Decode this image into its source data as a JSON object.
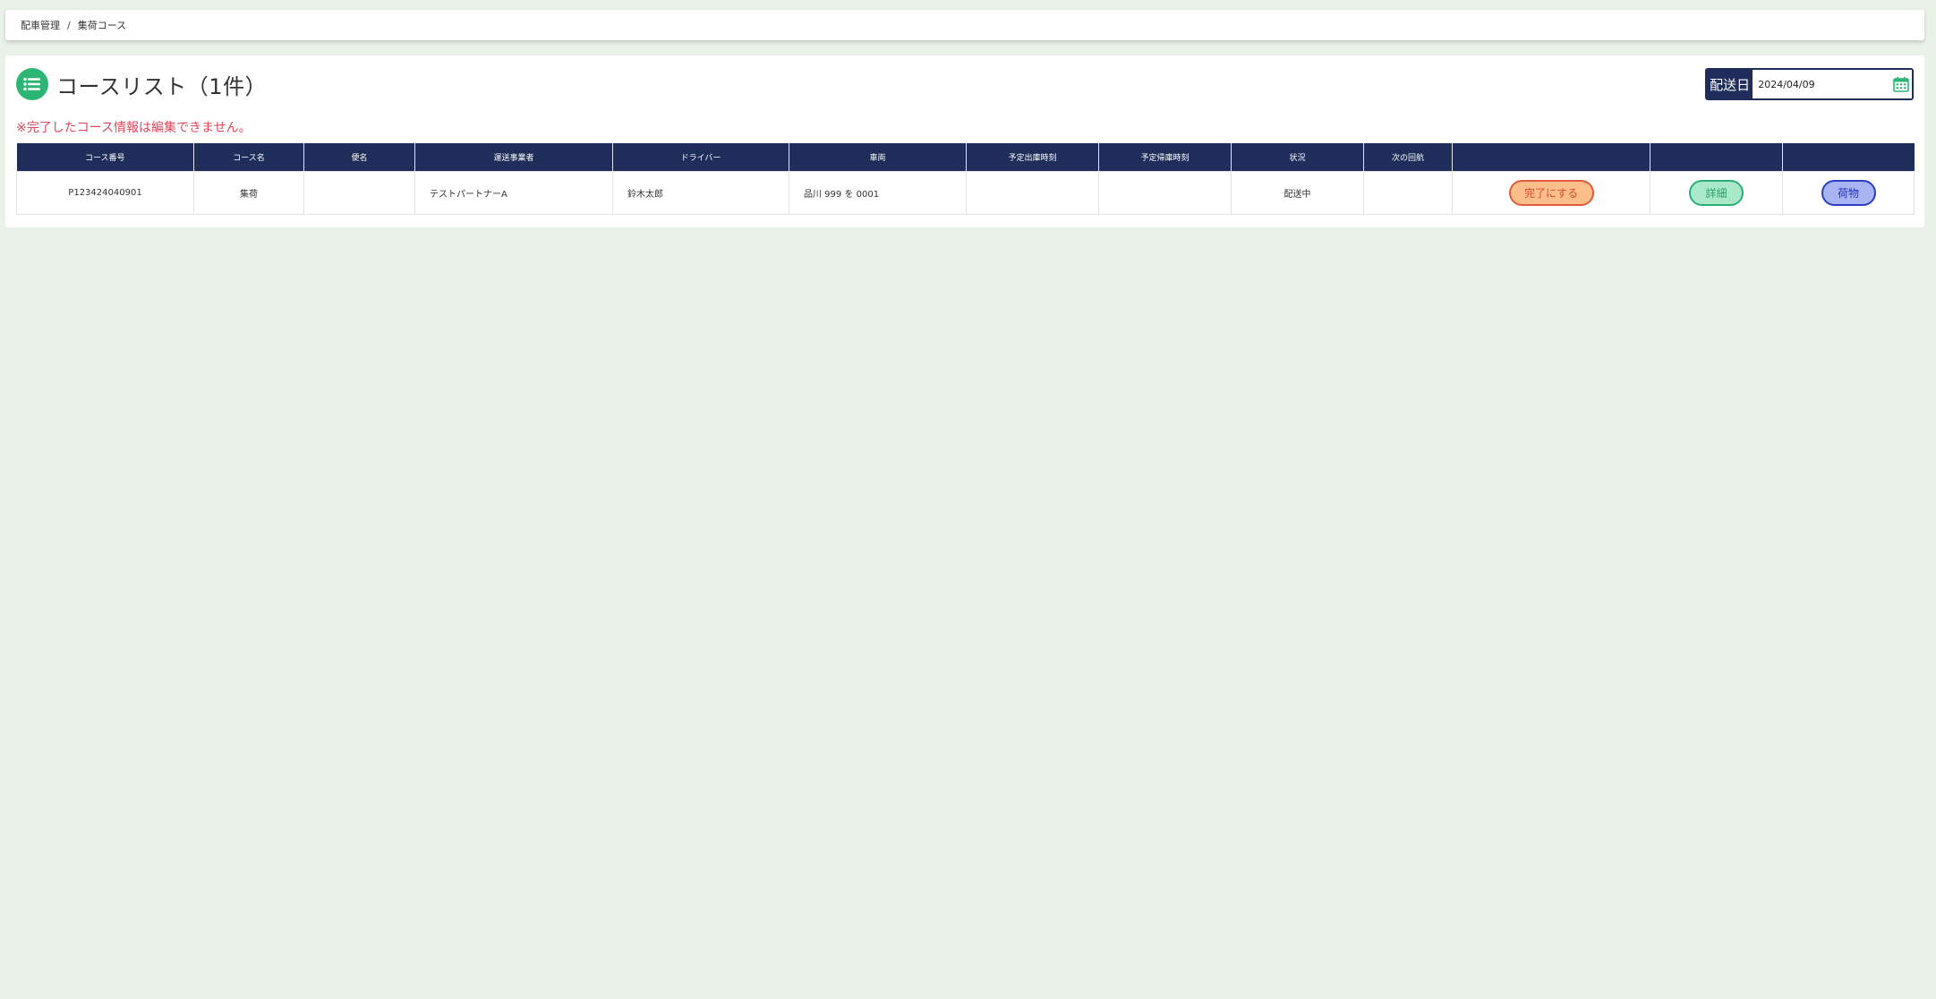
{
  "breadcrumb": {
    "items": [
      "配車管理",
      "集荷コース"
    ],
    "separator": "/"
  },
  "header": {
    "title": "コースリスト（1件）",
    "icon": "list-icon",
    "accent_color": "#2bb673"
  },
  "date_filter": {
    "label": "配送日",
    "value": "2024/04/09",
    "icon": "calendar-icon"
  },
  "notice": "※完了したコース情報は編集できません。",
  "table": {
    "columns": [
      "コース番号",
      "コース名",
      "便名",
      "運送事業者",
      "ドライバー",
      "車両",
      "予定出庫時刻",
      "予定帰庫時刻",
      "状況",
      "次の回航",
      "",
      "",
      ""
    ],
    "rows": [
      {
        "course_number": "P123424040901",
        "course_name": "集荷",
        "flight_name": "",
        "carrier": "テストパートナーA",
        "driver": "鈴木太郎",
        "vehicle": "品川 999 を 0001",
        "planned_departure": "",
        "planned_return": "",
        "status": "配送中",
        "next_route": "",
        "complete_label": "完了にする",
        "detail_label": "詳細",
        "cargo_label": "荷物"
      }
    ]
  },
  "colors": {
    "header_bg": "#1e2d5a",
    "notice": "#e0475a",
    "complete_border": "#e35b3a",
    "detail_border": "#2ab077",
    "cargo_border": "#2c3fc3"
  }
}
